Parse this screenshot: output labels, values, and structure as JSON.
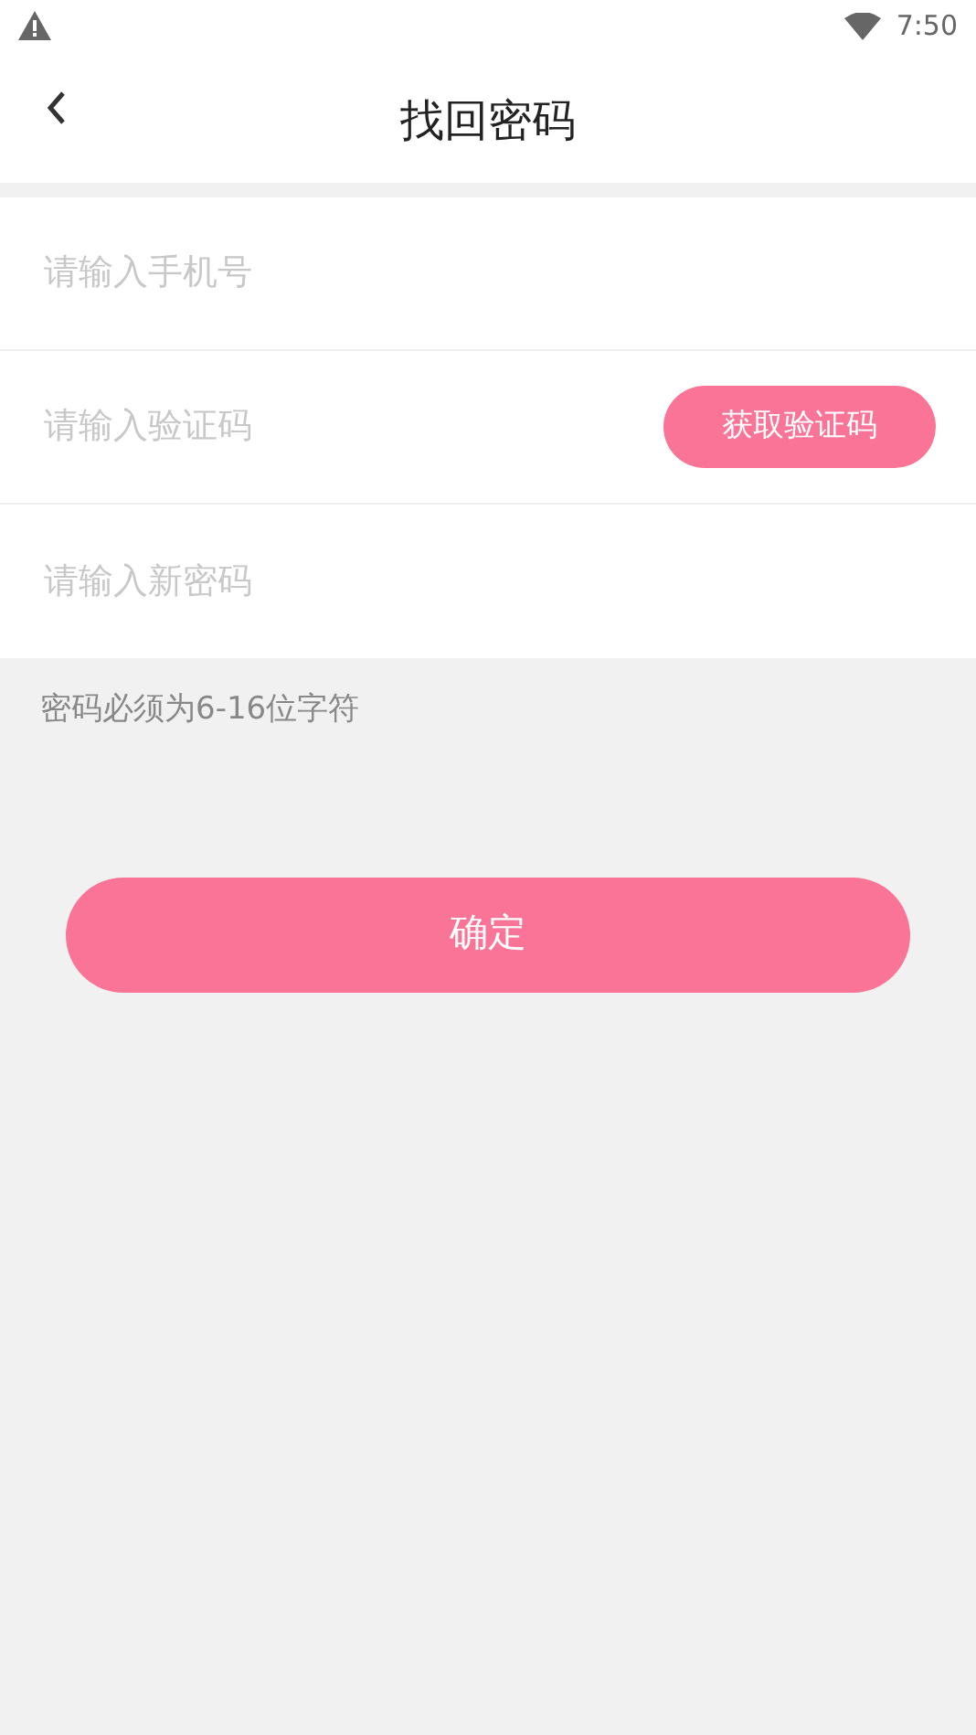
{
  "status_bar": {
    "time": "7:50"
  },
  "header": {
    "title": "找回密码"
  },
  "fields": [
    {
      "kind": "plain",
      "placeholder": "请输入手机号"
    },
    {
      "kind": "code",
      "placeholder": "请输入验证码",
      "button": "获取验证码"
    },
    {
      "kind": "plain",
      "placeholder": "请输入新密码"
    }
  ],
  "hint": "密码必须为6-16位字符",
  "submit": "确定"
}
